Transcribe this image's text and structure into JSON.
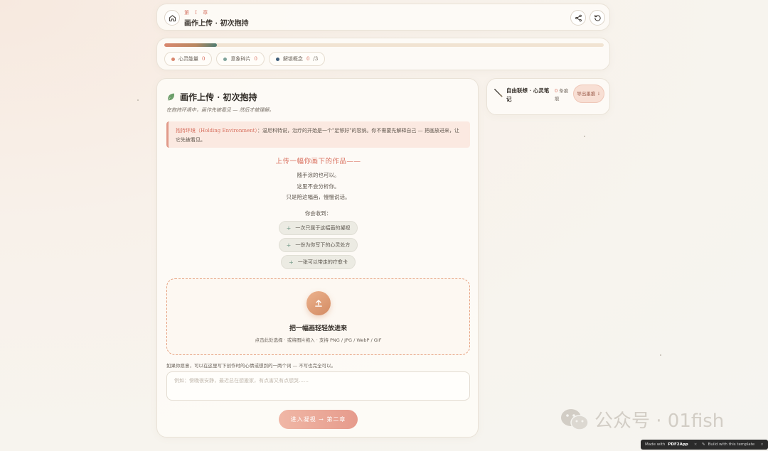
{
  "header": {
    "chapter_label": "第 I 章",
    "title": "画作上传 · 初次抱持",
    "icons": {
      "home": "home-icon",
      "share": "share-icon",
      "reset": "refresh-icon"
    }
  },
  "progress": {
    "value": 0.12,
    "chips": [
      {
        "label": "心灵能量",
        "count": "0",
        "color": "#d9876e"
      },
      {
        "label": "意象碎片",
        "count": "0",
        "color": "#7fa39a"
      },
      {
        "label": "解锁概念",
        "count": "0",
        "total": "/3",
        "color": "#3f5e7a"
      }
    ]
  },
  "main": {
    "icon": "leaf-icon",
    "title": "画作上传 · 初次抱持",
    "subtitle": "在抱持环境中，画作先被看见 — 然后才被理解。",
    "callout": {
      "term": "抱持环境（Holding Environment）",
      "text": "：温尼科特说，治疗的开始是一个\"足够好\"的容纳。你不需要先解释自己 — 把画放进来，让它先被看见。"
    },
    "upload_heading": "上传一幅你画下的作品——",
    "poem": [
      "随手涂的也可以。",
      "这里不会分析你。",
      "只是陪这幅画，慢慢说话。"
    ],
    "receive_label": "你会收到：",
    "benefits": [
      {
        "text": "一次只属于这幅画的凝视"
      },
      {
        "text": "一份为你写下的心灵处方"
      },
      {
        "text": "一张可以带走的疗愈卡"
      }
    ],
    "dropzone": {
      "icon": "upload-icon",
      "title": "把一幅画轻轻放进来",
      "hint": "点击此处选择 · 或将图片拖入 · 支持 PNG / JPG / WebP / GIF"
    },
    "note_label": "如果你愿意，可以在这里写下创作时的心情或想到的一两个词 — 不写也完全可以。",
    "note_placeholder": "例如：傍晚很安静，最近总在想搬家，有点害又有点想哭……",
    "enter_button": "进入凝视 → 第二章"
  },
  "side": {
    "icon": "brush-icon",
    "title": "自由联想 · 心灵笔记",
    "count": "0",
    "count_suffix": "条痕痕",
    "export_button": "导出墨痕 ↓"
  },
  "watermark": {
    "icon": "wechat-icon",
    "text": "公众号 · 01fish"
  },
  "badges": [
    {
      "prefix": "Made with",
      "brand": "PDF2App",
      "close": "×"
    },
    {
      "icon": "magic-icon",
      "text": "Build with this template",
      "close": "×"
    }
  ]
}
